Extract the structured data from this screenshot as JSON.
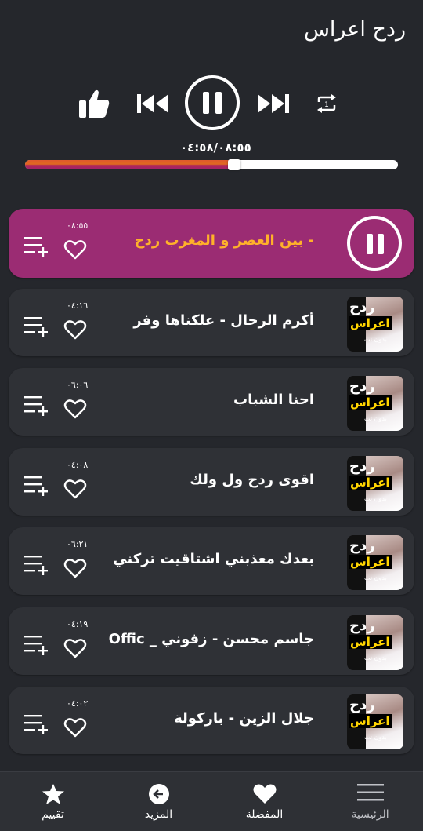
{
  "header": {
    "title": "ردح اعراس"
  },
  "player": {
    "icons": [
      "thumbs-up-icon",
      "previous-icon",
      "pause-icon",
      "next-icon",
      "repeat-one-icon"
    ],
    "time_readout": "٠٤:٥٨/٠٨:٥٥",
    "progress_fraction": 0.56,
    "progress_colors": [
      "#e06a20",
      "#a0206a"
    ]
  },
  "thumbnail": {
    "line1": "ردح",
    "line2": "اعراس",
    "line3": "بدون نت"
  },
  "songs": [
    {
      "title": "- بين العصر و المغرب ردح",
      "duration": "٠٨:٥٥",
      "active": true
    },
    {
      "title": "أكرم الرحال - علكناها وفر",
      "duration": "٠٤:١٦"
    },
    {
      "title": "احنا الشباب",
      "duration": "٠٦:٠٦"
    },
    {
      "title": "اقوى ردح ول ولك",
      "duration": "٠٤:٠٨"
    },
    {
      "title": "بعدك معذبني اشتاقيت تركني",
      "duration": "٠٦:٢١"
    },
    {
      "title": "جاسم محسن - زفوني _ Offic",
      "duration": "٠٤:١٩"
    },
    {
      "title": "جلال الزين - باركولة",
      "duration": "٠٤:٠٢"
    }
  ],
  "colors": {
    "background": "#25272c",
    "row": "#2f3136",
    "active_row": "#9b2c73",
    "active_title": "#ffb12a"
  },
  "bottom_nav": [
    {
      "label": "تقييم",
      "icon": "star-icon"
    },
    {
      "label": "المزيد",
      "icon": "arrow-left-circle-icon"
    },
    {
      "label": "المفضلة",
      "icon": "heart-icon"
    },
    {
      "label": "الرئيسية",
      "icon": "menu-icon"
    }
  ]
}
